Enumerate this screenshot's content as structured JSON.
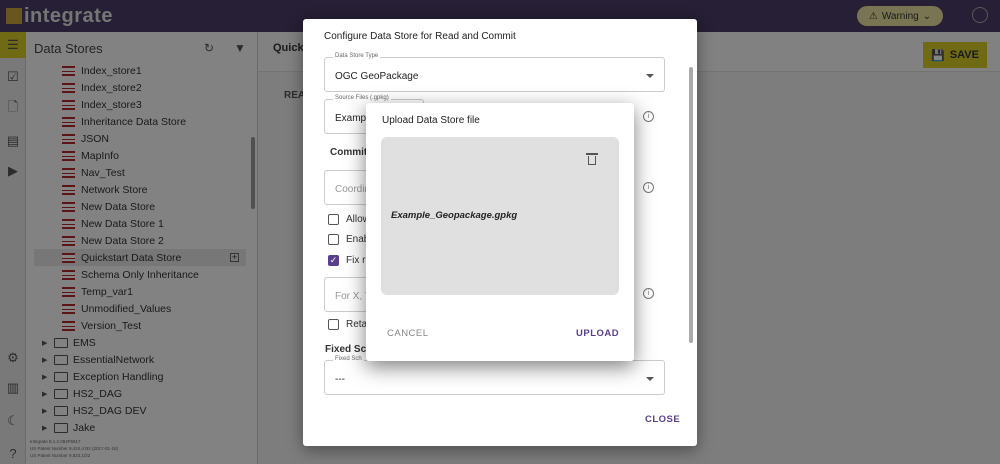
{
  "app": {
    "name": "integrate"
  },
  "topbar": {
    "warning_label": "Warning"
  },
  "tree": {
    "title": "Data Stores",
    "stores": [
      "Index_store1",
      "Index_store2",
      "Index_store3",
      "Inheritance Data Store",
      "JSON",
      "MapInfo",
      "Nav_Test",
      "Network Store",
      "New Data Store",
      "New Data Store 1",
      "New Data Store 2",
      "Quickstart Data Store",
      "Schema Only Inheritance",
      "Temp_var1",
      "Unmodified_Values",
      "Version_Test"
    ],
    "selected": "Quickstart Data Store",
    "folders": [
      "EMS",
      "EssentialNetwork",
      "Exception Handling",
      "HS2_DAG",
      "HS2_DAG DEV",
      "Jake"
    ],
    "footer": [
      "Integrate 8.1.2.084F5817",
      "US Patent Number 9,424,4 B2 (2017-01-16)",
      "US Patent Number 9,823,1/22"
    ]
  },
  "main": {
    "title_partial": "Quick",
    "tab_partial": "REA",
    "save_label": "SAVE"
  },
  "configure_dialog": {
    "title": "Configure Data Store for Read and Commit",
    "data_store_type": {
      "label": "Data Store Type",
      "value": "OGC GeoPackage"
    },
    "source_files": {
      "label": "Source Files (.gpkg)",
      "value_partial": "Exampl"
    },
    "commit_heading_partial": "Commit",
    "coord_placeholder_partial": "Coordin",
    "checkbox_allow": {
      "label_partial": "Allow",
      "checked": false
    },
    "checkbox_enable": {
      "label_partial": "Enab",
      "checked": false
    },
    "checkbox_fix": {
      "label_partial": "Fix ri",
      "checked": true
    },
    "xy_placeholder_partial": "For X, Y",
    "checkbox_retain": {
      "label_partial": "Reta",
      "checked": false
    },
    "fixed_schema_heading_partial": "Fixed Sch",
    "fixed_schema_field": {
      "label_partial": "Fixed Sch",
      "value": "---"
    },
    "close_label": "CLOSE"
  },
  "upload_dialog": {
    "title": "Upload Data Store file",
    "file_name": "Example_Geopackage.gpkg",
    "cancel_label": "CANCEL",
    "upload_label": "UPLOAD"
  },
  "colors": {
    "accent": "#5b3f8f",
    "topbar": "#4a3c66",
    "save": "#d6cc2a",
    "warning": "#e8e0a0"
  }
}
